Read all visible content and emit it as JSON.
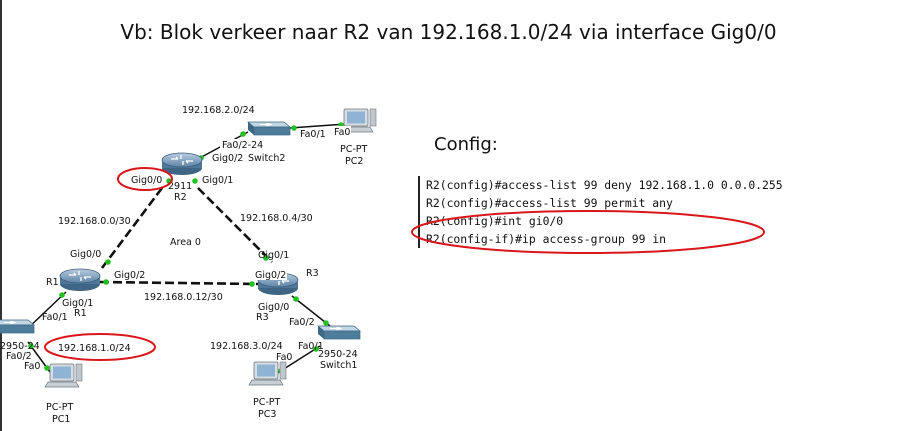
{
  "title": "Vb: Blok verkeer naar R2 van 192.168.1.0/24 via interface Gig0/0",
  "config": {
    "heading": "Config:",
    "lines": [
      "R2(config)#access-list 99 deny 192.168.1.0 0.0.0.255",
      "R2(config)#access-list 99 permit any",
      "R2(config)#int gi0/0",
      "R2(config-if)#ip access-group 99 in"
    ]
  },
  "topology": {
    "area_label": "Area 0",
    "routers": {
      "r1": {
        "name": "R1",
        "name2": "R1"
      },
      "r2": {
        "model": "2911",
        "name": "R2"
      },
      "r3": {
        "name": "R3",
        "name2": "R3"
      }
    },
    "switches": {
      "switch2": {
        "model_port": "Fa0/2-24",
        "gig_port": "Gig0/2",
        "name": "Switch2"
      },
      "switch1": {
        "model": "2950-24",
        "name": "Switch1"
      },
      "left": {
        "model": "2950-24"
      }
    },
    "pcs": {
      "pc1": {
        "type": "PC-PT",
        "name": "PC1"
      },
      "pc2": {
        "type": "PC-PT",
        "name": "PC2"
      },
      "pc3": {
        "type": "PC-PT",
        "name": "PC3"
      }
    },
    "networks": {
      "net_2": "192.168.2.0/24",
      "net_0": "192.168.0.0/30",
      "net_4": "192.168.0.4/30",
      "net_12": "192.168.0.12/30",
      "net_1": "192.168.1.0/24",
      "net_3": "192.168.3.0/24"
    },
    "interfaces": {
      "r2_gig00": "Gig0/0",
      "r2_gig01": "Gig0/1",
      "r1_gig00": "Gig0/0",
      "r1_gig02": "Gig0/2",
      "r1_gig01": "Gig0/1",
      "r1_fa01": "Fa0/1",
      "r3_gig01": "Gig0/1",
      "r3_gig02": "Gig0/2",
      "r3_gig00": "Gig0/0",
      "r3_fa02": "Fa0/2",
      "sw2_fa01": "Fa0/1",
      "pc2_fa0": "Fa0",
      "sw1_fa01": "Fa0/1",
      "pc3_fa0": "Fa0",
      "left_fa02": "Fa0/2",
      "pc1_fa0": "Fa0"
    }
  },
  "colors": {
    "highlight_ellipse": "#d8161b",
    "link_up": "#22c022",
    "router_body": "#6f94b4",
    "switch_body": "#5b8aa6"
  }
}
